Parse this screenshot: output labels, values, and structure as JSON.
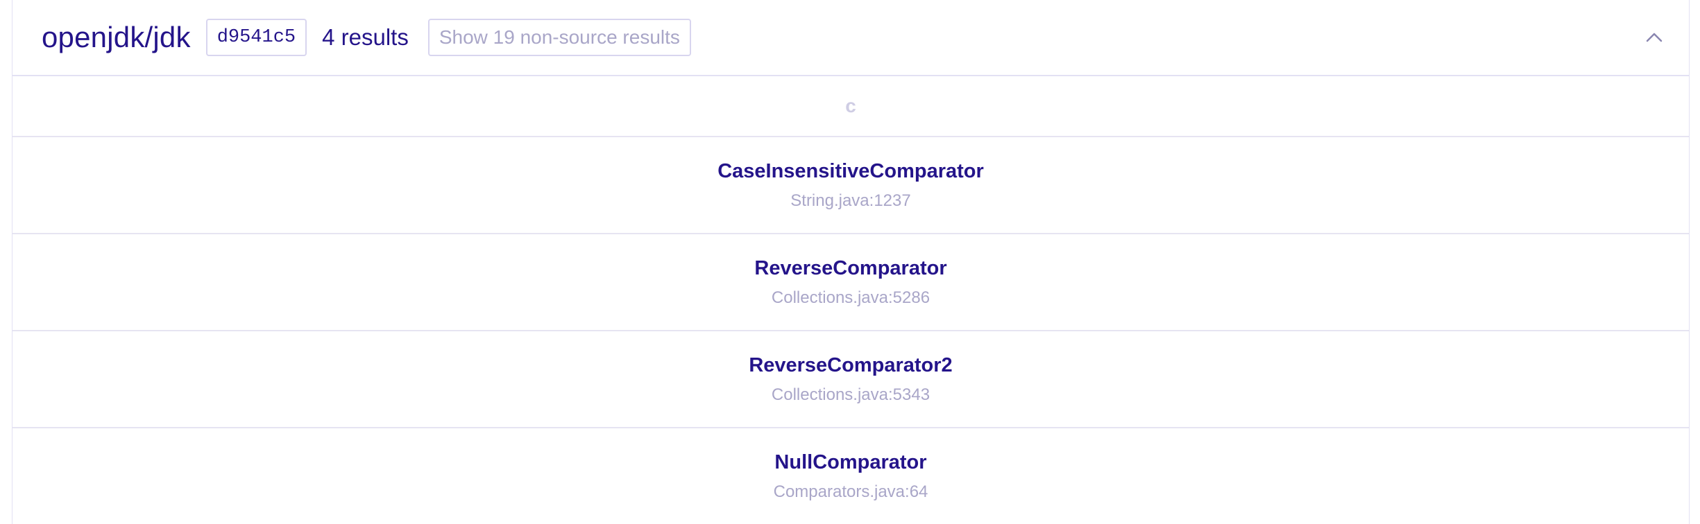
{
  "header": {
    "repo_name": "openjdk/jdk",
    "commit": "d9541c5",
    "result_count": "4 results",
    "show_button": "Show 19 non-source results",
    "collapse_icon": "chevron-up-icon"
  },
  "section": {
    "letter": "c"
  },
  "results": [
    {
      "name": "CaseInsensitiveComparator",
      "location": "String.java:1237"
    },
    {
      "name": "ReverseComparator",
      "location": "Collections.java:5286"
    },
    {
      "name": "ReverseComparator2",
      "location": "Collections.java:5343"
    },
    {
      "name": "NullComparator",
      "location": "Comparators.java:64"
    }
  ],
  "colors": {
    "accent": "#24148a",
    "muted": "#a9a6c8",
    "border": "#e3e1f4"
  }
}
